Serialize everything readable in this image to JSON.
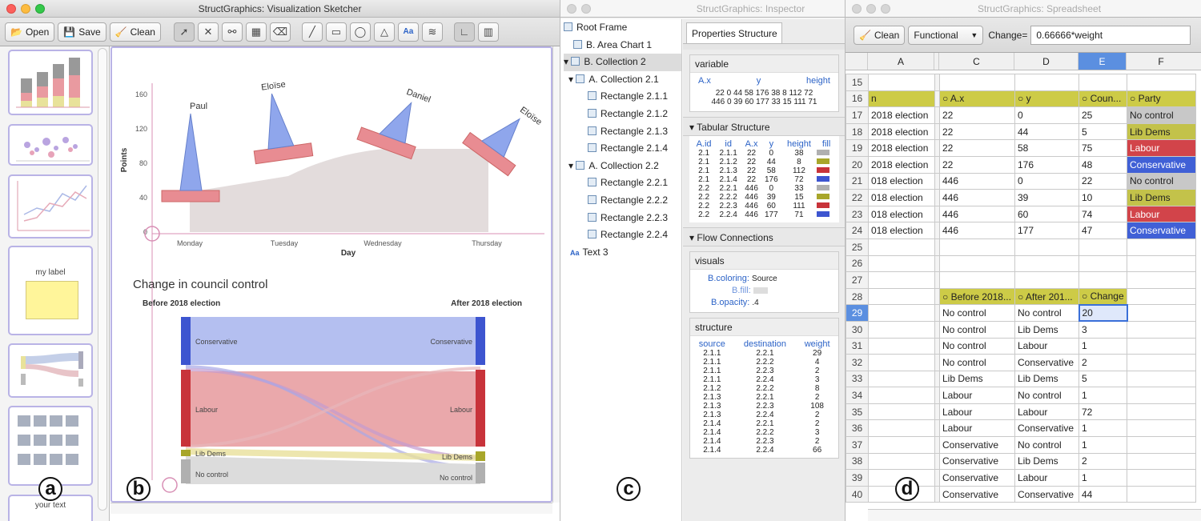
{
  "sketcher": {
    "title": "StructGraphics: Visualization Sketcher",
    "open": "Open",
    "save": "Save",
    "clean": "Clean",
    "thumb_label": "my label",
    "thumb_text": "your text",
    "chart": {
      "ylabel": "Points",
      "xlabel": "Day",
      "yticks": [
        "160",
        "120",
        "80",
        "40",
        "0"
      ],
      "xticks": [
        "Monday",
        "Tuesday",
        "Wednesday",
        "Thursday"
      ],
      "names": [
        "Paul",
        "Eloïse",
        "Daniel",
        "Eloïse"
      ]
    },
    "sankey": {
      "title": "Change in council control",
      "left": "Before 2018 election",
      "right": "After 2018 election",
      "parties": [
        "Conservative",
        "Labour",
        "Lib Dems",
        "No control"
      ]
    }
  },
  "inspector": {
    "title": "StructGraphics: Inspector",
    "tab": "Properties Structure",
    "tree": [
      "Root Frame",
      "B. Area Chart 1",
      "B. Collection 2",
      "A. Collection 2.1",
      "Rectangle 2.1.1",
      "Rectangle 2.1.2",
      "Rectangle 2.1.3",
      "Rectangle 2.1.4",
      "A. Collection 2.2",
      "Rectangle 2.2.1",
      "Rectangle 2.2.2",
      "Rectangle 2.2.3",
      "Rectangle 2.2.4",
      "Text 3"
    ],
    "variable": {
      "header": "variable",
      "cols": [
        "A.x",
        "y",
        "height"
      ],
      "r1": "22   0 44 58 176    38  8 112 72",
      "r2": "446   0 39 60 177    33 15 111 71"
    },
    "tabular": {
      "header": "Tabular Structure",
      "cols": [
        "A.id",
        "id",
        "A.x",
        "y",
        "height",
        "fill"
      ],
      "rows": [
        [
          "2.1",
          "2.1.1",
          "22",
          "0",
          "38"
        ],
        [
          "2.1",
          "2.1.2",
          "22",
          "44",
          "8"
        ],
        [
          "2.1",
          "2.1.3",
          "22",
          "58",
          "112"
        ],
        [
          "2.1",
          "2.1.4",
          "22",
          "176",
          "72"
        ],
        [
          "2.2",
          "2.2.1",
          "446",
          "0",
          "33"
        ],
        [
          "2.2",
          "2.2.2",
          "446",
          "39",
          "15"
        ],
        [
          "2.2",
          "2.2.3",
          "446",
          "60",
          "111"
        ],
        [
          "2.2",
          "2.2.4",
          "446",
          "177",
          "71"
        ]
      ],
      "fills": [
        "#b0b0b0",
        "#a8a62a",
        "#c8333a",
        "#3d55d0",
        "#b0b0b0",
        "#a8a62a",
        "#c8333a",
        "#3d55d0"
      ]
    },
    "flow": "Flow Connections",
    "visuals": {
      "header": "visuals",
      "coloring": "B.coloring:",
      "coloring_v": "Source",
      "fill": "B.fill:",
      "opacity": "B.opacity:",
      "opacity_v": ".4"
    },
    "structure": {
      "header": "structure",
      "cols": [
        "source",
        "destination",
        "weight"
      ],
      "rows": [
        [
          "2.1.1",
          "2.2.1",
          "29"
        ],
        [
          "2.1.1",
          "2.2.2",
          "4"
        ],
        [
          "2.1.1",
          "2.2.3",
          "2"
        ],
        [
          "2.1.1",
          "2.2.4",
          "3"
        ],
        [
          "2.1.2",
          "2.2.2",
          "8"
        ],
        [
          "2.1.3",
          "2.2.1",
          "2"
        ],
        [
          "2.1.3",
          "2.2.3",
          "108"
        ],
        [
          "2.1.3",
          "2.2.4",
          "2"
        ],
        [
          "2.1.4",
          "2.2.1",
          "2"
        ],
        [
          "2.1.4",
          "2.2.2",
          "3"
        ],
        [
          "2.1.4",
          "2.2.3",
          "2"
        ],
        [
          "2.1.4",
          "2.2.4",
          "66"
        ]
      ]
    }
  },
  "spreadsheet": {
    "title": "StructGraphics: Spreadsheet",
    "clean": "Clean",
    "mode": "Functional",
    "change_label": "Change=",
    "formula": "0.66666*weight",
    "cols": [
      "A",
      "C",
      "D",
      "E",
      "F"
    ],
    "rows": [
      [
        "15",
        "",
        "",
        "",
        "",
        ""
      ],
      [
        "16",
        "n",
        "A.x",
        "y",
        "Coun...",
        "Party"
      ],
      [
        "17",
        "2018 election",
        "22",
        "0",
        "25",
        "No control"
      ],
      [
        "18",
        "2018 election",
        "22",
        "44",
        "5",
        "Lib Dems"
      ],
      [
        "19",
        "2018 election",
        "22",
        "58",
        "75",
        "Labour"
      ],
      [
        "20",
        "2018 election",
        "22",
        "176",
        "48",
        "Conservative"
      ],
      [
        "21",
        "018 election",
        "446",
        "0",
        "22",
        "No control"
      ],
      [
        "22",
        "018 election",
        "446",
        "39",
        "10",
        "Lib Dems"
      ],
      [
        "23",
        "018 election",
        "446",
        "60",
        "74",
        "Labour"
      ],
      [
        "24",
        "018 election",
        "446",
        "177",
        "47",
        "Conservative"
      ],
      [
        "25",
        "",
        "",
        "",
        "",
        ""
      ],
      [
        "26",
        "",
        "",
        "",
        "",
        ""
      ],
      [
        "27",
        "",
        "",
        "",
        "",
        ""
      ],
      [
        "28",
        "",
        "Before 2018...",
        "After 201...",
        "Change",
        ""
      ],
      [
        "29",
        "",
        "No control",
        "No control",
        "20",
        ""
      ],
      [
        "30",
        "",
        "No control",
        "Lib Dems",
        "3",
        ""
      ],
      [
        "31",
        "",
        "No control",
        "Labour",
        "1",
        ""
      ],
      [
        "32",
        "",
        "No control",
        "Conservative",
        "2",
        ""
      ],
      [
        "33",
        "",
        "Lib Dems",
        "Lib Dems",
        "5",
        ""
      ],
      [
        "34",
        "",
        "Labour",
        "No control",
        "1",
        ""
      ],
      [
        "35",
        "",
        "Labour",
        "Labour",
        "72",
        ""
      ],
      [
        "36",
        "",
        "Labour",
        "Conservative",
        "1",
        ""
      ],
      [
        "37",
        "",
        "Conservative",
        "No control",
        "1",
        ""
      ],
      [
        "38",
        "",
        "Conservative",
        "Lib Dems",
        "2",
        ""
      ],
      [
        "39",
        "",
        "Conservative",
        "Labour",
        "1",
        ""
      ],
      [
        "40",
        "",
        "Conservative",
        "Conservative",
        "44",
        ""
      ]
    ]
  },
  "labels": {
    "a": "a",
    "b": "b",
    "c": "c",
    "d": "d"
  }
}
